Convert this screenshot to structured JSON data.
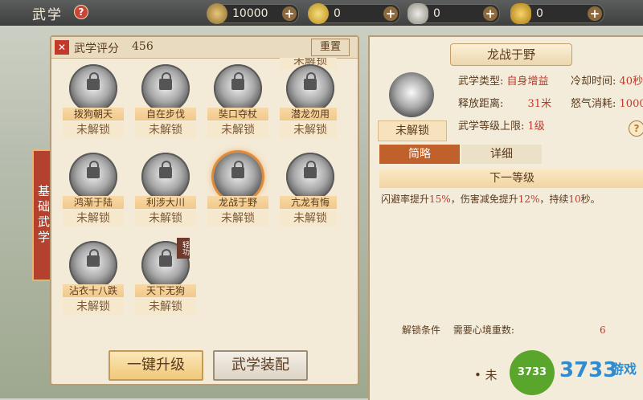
{
  "topbar": {
    "title": "武学",
    "help": "?",
    "resources": [
      {
        "icon": "coin-icon",
        "value": "10000"
      },
      {
        "icon": "gold-coin-icon",
        "value": "0"
      },
      {
        "icon": "silver-ingot-icon",
        "value": "0"
      },
      {
        "icon": "gold-ingot-icon",
        "value": "0"
      }
    ]
  },
  "left": {
    "score_label": "武学评分",
    "score_value": "456",
    "reset_label": "重置",
    "side_tab": "基础武学",
    "skills": [
      {
        "name": "拨狗朝天",
        "state": "未解锁"
      },
      {
        "name": "自在步伐",
        "state": "未解锁"
      },
      {
        "name": "奘口夺杖",
        "state": "未解锁"
      },
      {
        "name": "潜龙勿用",
        "state": "未解锁"
      },
      {
        "name": "鸿渐于陆",
        "state": "未解锁"
      },
      {
        "name": "利涉大川",
        "state": "未解锁"
      },
      {
        "name": "龙战于野",
        "state": "未解锁"
      },
      {
        "name": "亢龙有悔",
        "state": "未解锁"
      },
      {
        "name": "沾衣十八跌",
        "state": "未解锁"
      },
      {
        "name": "天下无狗",
        "state": "未解锁",
        "badge": "轻功"
      }
    ],
    "partial_top_state": "未解锁",
    "upgrade_button": "一键升级",
    "equip_button": "武学装配"
  },
  "right": {
    "title": "龙战于野",
    "state": "未解锁",
    "type_label": "武学类型:",
    "type_value": "自身增益",
    "cooldown_label": "冷却时间:",
    "cooldown_value": "40秒",
    "range_label": "释放距离:",
    "range_value": "31米",
    "rage_label": "怒气消耗:",
    "rage_value": "1000",
    "level_label": "武学等级上限:",
    "level_value": "1级",
    "help": "?",
    "tab_brief": "简略",
    "tab_detail": "详细",
    "next_level_header": "下一等级",
    "desc_part1": "闪避率提升",
    "desc_val1": "15%",
    "desc_part2": "，伤害减免提升",
    "desc_val2": "12%",
    "desc_part3": "，持续",
    "desc_val3": "10",
    "desc_part4": "秒。",
    "unlock_label": "解锁条件",
    "unlock_req": "需要心境重数:",
    "unlock_value": "6",
    "footer_status": "• 未"
  },
  "watermark": {
    "circle": "3733",
    "text": "3733",
    "small": "游戏"
  }
}
